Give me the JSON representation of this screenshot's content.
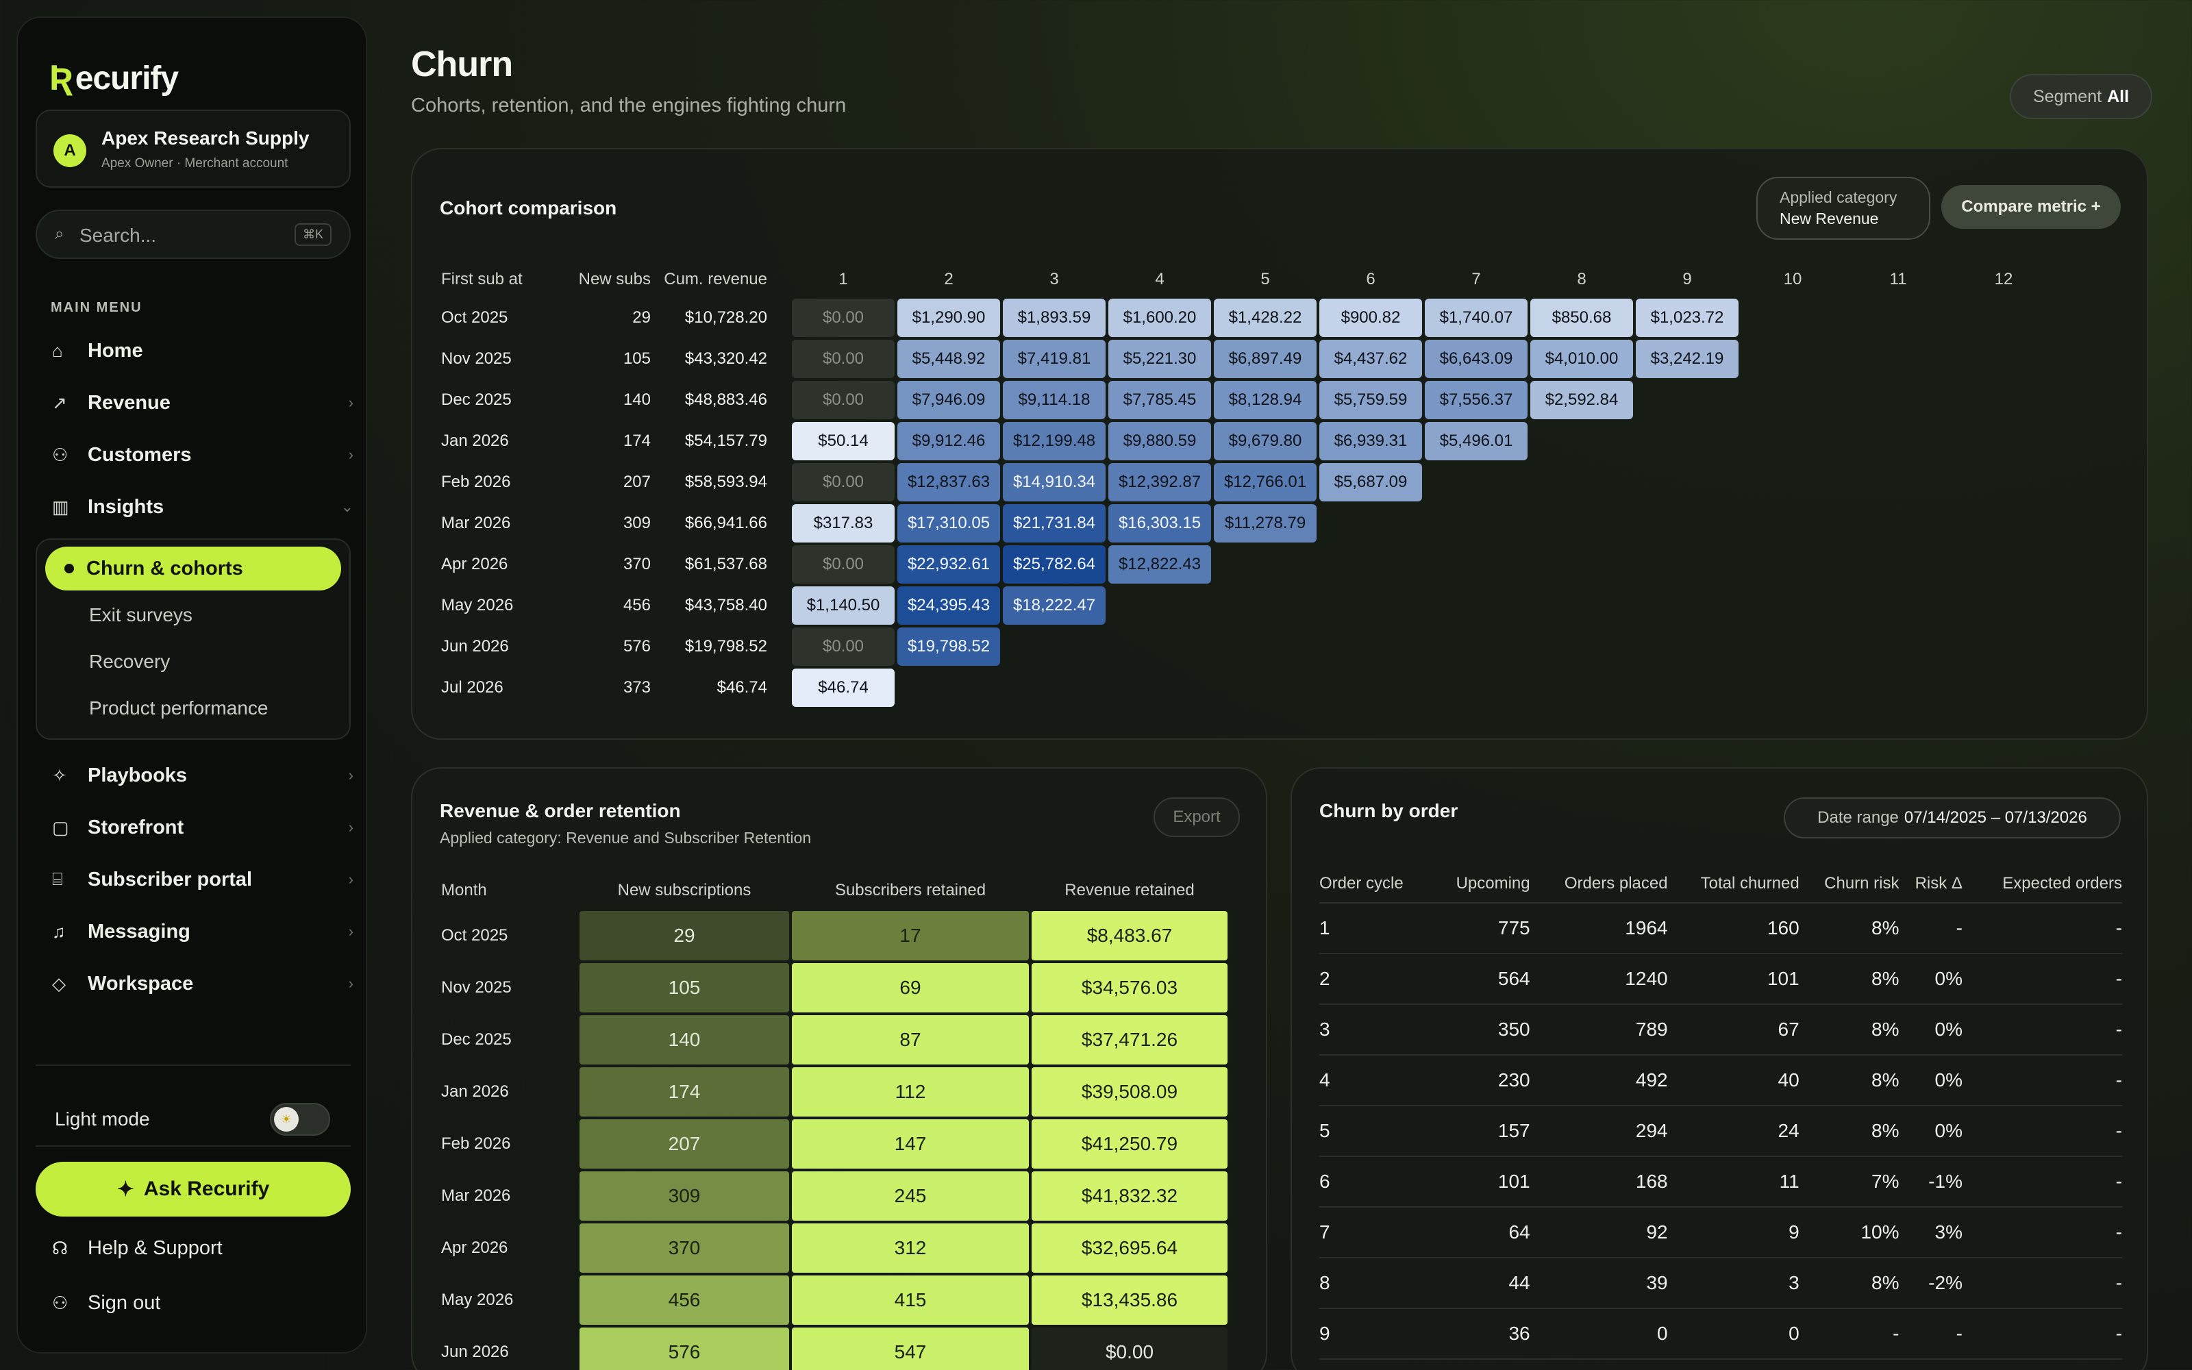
{
  "brand": {
    "name": "ecurify",
    "accent": "#c4ee3e"
  },
  "account": {
    "initial": "A",
    "name": "Apex Research Supply",
    "subtitle": "Apex Owner · Merchant account"
  },
  "search": {
    "placeholder": "Search...",
    "shortcut": "⌘K"
  },
  "menu_heading": "MAIN MENU",
  "nav": [
    {
      "label": "Home",
      "icon": "home-icon"
    },
    {
      "label": "Revenue",
      "icon": "trend-icon"
    },
    {
      "label": "Customers",
      "icon": "users-icon"
    },
    {
      "label": "Insights",
      "icon": "chart-icon"
    }
  ],
  "insights_sub": {
    "active": "Churn & cohorts",
    "items": [
      "Exit surveys",
      "Recovery",
      "Product performance"
    ]
  },
  "nav2": [
    {
      "label": "Playbooks",
      "icon": "sparkle-icon"
    },
    {
      "label": "Storefront",
      "icon": "bag-icon"
    },
    {
      "label": "Subscriber portal",
      "icon": "store-icon"
    },
    {
      "label": "Messaging",
      "icon": "bell-icon"
    },
    {
      "label": "Workspace",
      "icon": "tag-icon"
    }
  ],
  "light_mode_label": "Light mode",
  "ask_label": "Ask Recurify",
  "help_label": "Help & Support",
  "signout_label": "Sign out",
  "page": {
    "title": "Churn",
    "subtitle": "Cohorts, retention, and the engines fighting churn",
    "segment_label": "Segment",
    "segment_value": "All"
  },
  "cohort": {
    "title": "Cohort comparison",
    "applied_label": "Applied category",
    "applied_value": "New Revenue",
    "compare_label": "Compare metric +",
    "headers": [
      "First sub at",
      "New subs",
      "Cum. revenue",
      "1",
      "2",
      "3",
      "4",
      "5",
      "6",
      "7",
      "8",
      "9",
      "10",
      "11",
      "12"
    ],
    "rows": [
      {
        "month": "Oct 2025",
        "new": "29",
        "cum": "$10,728.20",
        "cells": [
          "$0.00",
          "$1,290.90",
          "$1,893.59",
          "$1,600.20",
          "$1,428.22",
          "$900.82",
          "$1,740.07",
          "$850.68",
          "$1,023.72"
        ]
      },
      {
        "month": "Nov 2025",
        "new": "105",
        "cum": "$43,320.42",
        "cells": [
          "$0.00",
          "$5,448.92",
          "$7,419.81",
          "$5,221.30",
          "$6,897.49",
          "$4,437.62",
          "$6,643.09",
          "$4,010.00",
          "$3,242.19"
        ]
      },
      {
        "month": "Dec 2025",
        "new": "140",
        "cum": "$48,883.46",
        "cells": [
          "$0.00",
          "$7,946.09",
          "$9,114.18",
          "$7,785.45",
          "$8,128.94",
          "$5,759.59",
          "$7,556.37",
          "$2,592.84"
        ]
      },
      {
        "month": "Jan 2026",
        "new": "174",
        "cum": "$54,157.79",
        "cells": [
          "$50.14",
          "$9,912.46",
          "$12,199.48",
          "$9,880.59",
          "$9,679.80",
          "$6,939.31",
          "$5,496.01"
        ]
      },
      {
        "month": "Feb 2026",
        "new": "207",
        "cum": "$58,593.94",
        "cells": [
          "$0.00",
          "$12,837.63",
          "$14,910.34",
          "$12,392.87",
          "$12,766.01",
          "$5,687.09"
        ]
      },
      {
        "month": "Mar 2026",
        "new": "309",
        "cum": "$66,941.66",
        "cells": [
          "$317.83",
          "$17,310.05",
          "$21,731.84",
          "$16,303.15",
          "$11,278.79"
        ]
      },
      {
        "month": "Apr 2026",
        "new": "370",
        "cum": "$61,537.68",
        "cells": [
          "$0.00",
          "$22,932.61",
          "$25,782.64",
          "$12,822.43"
        ]
      },
      {
        "month": "May 2026",
        "new": "456",
        "cum": "$43,758.40",
        "cells": [
          "$1,140.50",
          "$24,395.43",
          "$18,222.47"
        ]
      },
      {
        "month": "Jun 2026",
        "new": "576",
        "cum": "$19,798.52",
        "cells": [
          "$0.00",
          "$19,798.52"
        ]
      },
      {
        "month": "Jul 2026",
        "new": "373",
        "cum": "$46.74",
        "cells": [
          "$46.74"
        ]
      }
    ]
  },
  "retention": {
    "title": "Revenue & order retention",
    "subtitle": "Applied category: Revenue and Subscriber Retention",
    "export_label": "Export",
    "headers": [
      "Month",
      "New subscriptions",
      "Subscribers retained",
      "Revenue retained"
    ],
    "rows": [
      {
        "month": "Oct 2025",
        "new": "29",
        "retained": "17",
        "revenue": "$8,483.67"
      },
      {
        "month": "Nov 2025",
        "new": "105",
        "retained": "69",
        "revenue": "$34,576.03"
      },
      {
        "month": "Dec 2025",
        "new": "140",
        "retained": "87",
        "revenue": "$37,471.26"
      },
      {
        "month": "Jan 2026",
        "new": "174",
        "retained": "112",
        "revenue": "$39,508.09"
      },
      {
        "month": "Feb 2026",
        "new": "207",
        "retained": "147",
        "revenue": "$41,250.79"
      },
      {
        "month": "Mar 2026",
        "new": "309",
        "retained": "245",
        "revenue": "$41,832.32"
      },
      {
        "month": "Apr 2026",
        "new": "370",
        "retained": "312",
        "revenue": "$32,695.64"
      },
      {
        "month": "May 2026",
        "new": "456",
        "retained": "415",
        "revenue": "$13,435.86"
      },
      {
        "month": "Jun 2026",
        "new": "576",
        "retained": "547",
        "revenue": "$0.00"
      }
    ]
  },
  "churn": {
    "title": "Churn by order",
    "date_label": "Date range",
    "date_value": "07/14/2025 – 07/13/2026",
    "headers": [
      "Order cycle",
      "Upcoming",
      "Orders placed",
      "Total churned",
      "Churn risk",
      "Risk Δ",
      "Expected orders"
    ],
    "rows": [
      {
        "cycle": "1",
        "upcoming": "775",
        "placed": "1964",
        "churned": "160",
        "risk": "8%",
        "delta": "-",
        "expected": "-"
      },
      {
        "cycle": "2",
        "upcoming": "564",
        "placed": "1240",
        "churned": "101",
        "risk": "8%",
        "delta": "0%",
        "expected": "-"
      },
      {
        "cycle": "3",
        "upcoming": "350",
        "placed": "789",
        "churned": "67",
        "risk": "8%",
        "delta": "0%",
        "expected": "-"
      },
      {
        "cycle": "4",
        "upcoming": "230",
        "placed": "492",
        "churned": "40",
        "risk": "8%",
        "delta": "0%",
        "expected": "-"
      },
      {
        "cycle": "5",
        "upcoming": "157",
        "placed": "294",
        "churned": "24",
        "risk": "8%",
        "delta": "0%",
        "expected": "-"
      },
      {
        "cycle": "6",
        "upcoming": "101",
        "placed": "168",
        "churned": "11",
        "risk": "7%",
        "delta": "-1%",
        "expected": "-"
      },
      {
        "cycle": "7",
        "upcoming": "64",
        "placed": "92",
        "churned": "9",
        "risk": "10%",
        "delta": "3%",
        "expected": "-"
      },
      {
        "cycle": "8",
        "upcoming": "44",
        "placed": "39",
        "churned": "3",
        "risk": "8%",
        "delta": "-2%",
        "expected": "-"
      },
      {
        "cycle": "9",
        "upcoming": "36",
        "placed": "0",
        "churned": "0",
        "risk": "-",
        "delta": "-",
        "expected": "-"
      }
    ]
  }
}
